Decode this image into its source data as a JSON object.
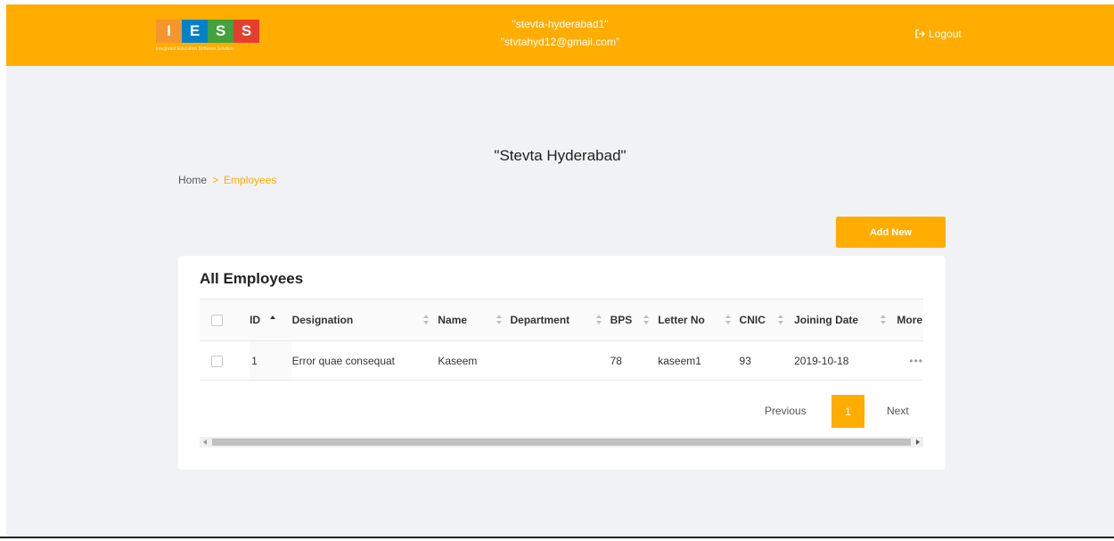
{
  "header": {
    "logo_letters": [
      "I",
      "E",
      "S",
      "S"
    ],
    "logo_tagline": "Integrated Education Software Solution",
    "username": "\"stevta-hyderabad1\"",
    "email": "\"stvtahyd12@gmail.com\"",
    "logout_label": "Logout"
  },
  "page": {
    "school_title": "\"Stevta Hyderabad\"",
    "breadcrumb": {
      "home": "Home",
      "separator": ">",
      "current": "Employees"
    },
    "add_button": "Add New"
  },
  "card": {
    "title": "All Employees",
    "columns": [
      "ID",
      "Designation",
      "Name",
      "Department",
      "BPS",
      "Letter No",
      "CNIC",
      "Joining Date",
      "More"
    ],
    "rows": [
      {
        "id": "1",
        "designation": "Error quae consequat",
        "name": "Kaseem",
        "department": "",
        "bps": "78",
        "letter_no": "kaseem1",
        "cnic": "93",
        "joining_date": "2019-10-18",
        "more": "•••"
      }
    ],
    "pagination": {
      "previous": "Previous",
      "current_page": "1",
      "next": "Next"
    }
  },
  "colors": {
    "accent": "#ffad00",
    "background": "#f1f2f5"
  }
}
